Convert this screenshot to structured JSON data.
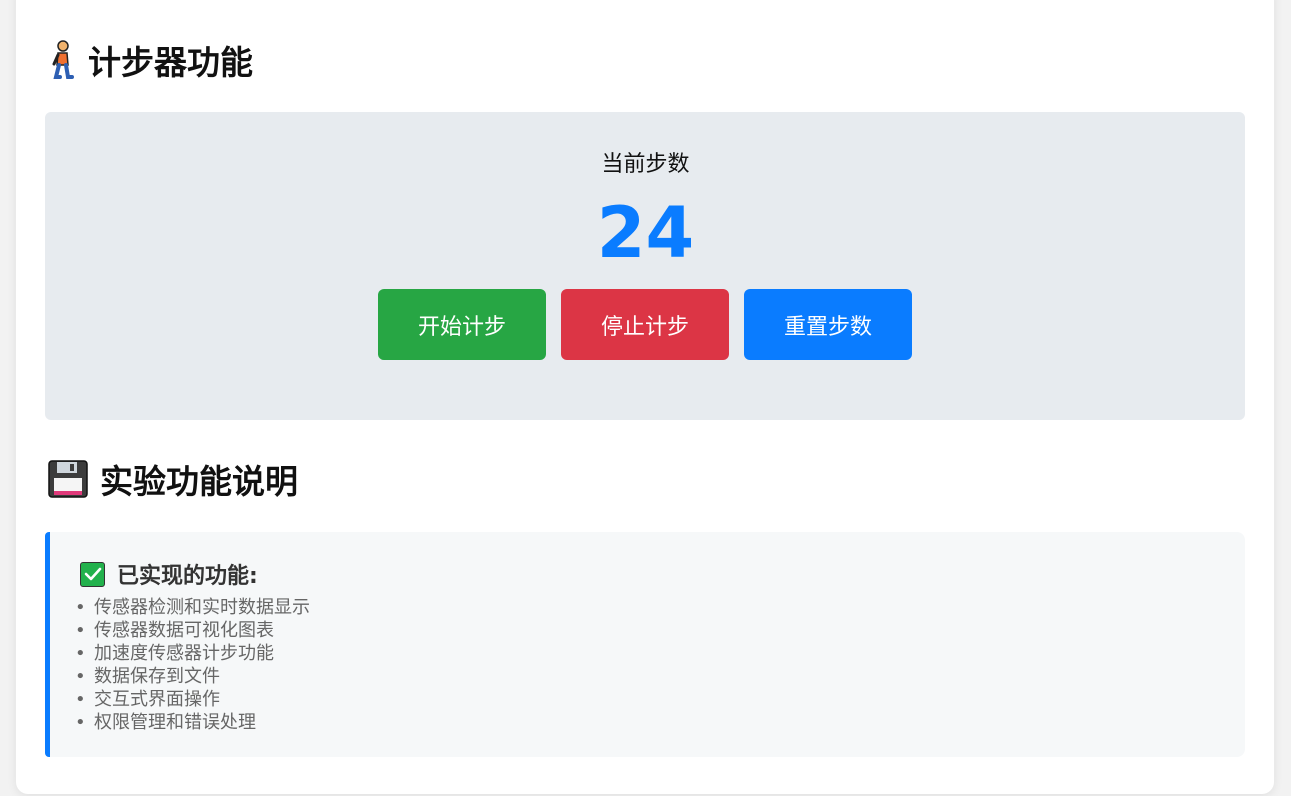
{
  "pedometer": {
    "title": "计步器功能",
    "current_steps_label": "当前步数",
    "step_count": "24",
    "buttons": {
      "start": "开始计步",
      "stop": "停止计步",
      "reset": "重置步数"
    },
    "icon": "walking-person-icon"
  },
  "experiment": {
    "title": "实验功能说明",
    "icon": "floppy-disk-icon",
    "features_heading": "已实现的功能:",
    "features_heading_icon": "check-mark-icon",
    "features": [
      "传感器检测和实时数据显示",
      "传感器数据可视化图表",
      "加速度传感器计步功能",
      "数据保存到文件",
      "交互式界面操作",
      "权限管理和错误处理"
    ]
  },
  "colors": {
    "accent": "#0a7cff",
    "start": "#27a644",
    "stop": "#dc3545",
    "reset": "#0a7cff",
    "panel": "#e7ebef"
  }
}
